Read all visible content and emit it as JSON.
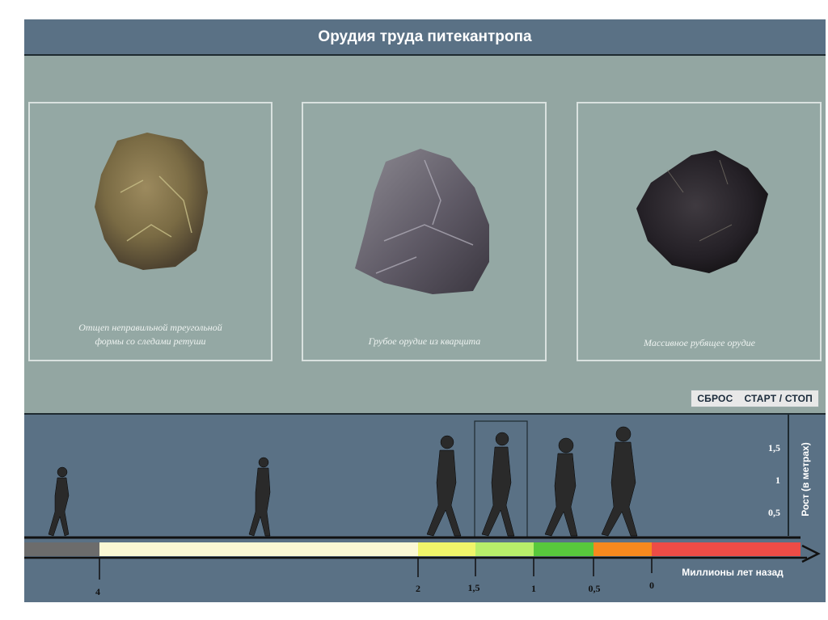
{
  "title": "Орудия труда питекантропа",
  "tools": [
    {
      "caption_line1": "Отщеп неправильной треугольной",
      "caption_line2": "формы со следами ретуши"
    },
    {
      "caption_line1": "Грубое орудие из кварцита",
      "caption_line2": ""
    },
    {
      "caption_line1": "Массивное рубящее орудие",
      "caption_line2": ""
    }
  ],
  "controls": {
    "reset_label": "СБРОС",
    "start_stop_label": "СТАРТ / СТОП"
  },
  "height_axis": {
    "title": "Рост (в метрах)",
    "ticks": [
      "1,5",
      "1",
      "0,5"
    ]
  },
  "time_axis": {
    "title": "Миллионы лет назад",
    "ticks": [
      "4",
      "2",
      "1,5",
      "1",
      "0,5",
      "0"
    ]
  },
  "timeline_colors": [
    "#6c6c6c",
    "#fbf8d4",
    "#f0f56a",
    "#b8ee6a",
    "#58c83c",
    "#f7891e",
    "#ee4c46"
  ],
  "figures": [
    "hominid-1",
    "hominid-2",
    "hominid-3",
    "hominid-4",
    "hominid-5",
    "hominid-6"
  ]
}
